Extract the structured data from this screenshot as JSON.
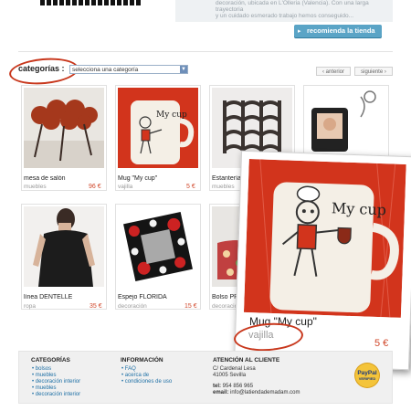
{
  "header": {
    "intro_line1": "decoración, ubicada en L'Olleria (Valencia). Con una larga trayectoria",
    "intro_line2": "y un cuidado esmerado trabajo hemos conseguido...",
    "recommend_button": "recomienda la tienda"
  },
  "filter": {
    "label": "categorías :",
    "select_value": "selecciona una categoría",
    "prev": "‹ anterior",
    "next": "siguiente ›"
  },
  "products": [
    {
      "name": "mesa de salón",
      "category": "muebles",
      "price": "96 €"
    },
    {
      "name": "Mug \"My cup\"",
      "category": "vajilla",
      "price": "5 €"
    },
    {
      "name": "Estantería BO",
      "category": "muebles",
      "price": ""
    },
    {
      "name": "",
      "category": "",
      "price": ""
    },
    {
      "name": "línea DENTELLE",
      "category": "ropa",
      "price": "35 €"
    },
    {
      "name": "Espejo FLORIDA",
      "category": "decoración",
      "price": "15 €"
    },
    {
      "name": "Bolso PRI",
      "category": "decoració",
      "price": ""
    }
  ],
  "zoom": {
    "name": "Mug \"My cup\"",
    "category": "vajilla",
    "price": "5 €",
    "mug_text": "My cup"
  },
  "footer": {
    "categories": {
      "title": "CATEGORÍAS",
      "links": [
        "bolsos",
        "muebles",
        "decoración interior",
        "muebles",
        "decoración interior"
      ]
    },
    "info": {
      "title": "INFORMACIÓN",
      "links": [
        "FAQ",
        "acerca de",
        "condiciones de uso"
      ]
    },
    "contact": {
      "title": "ATENCIÓN AL CLIENTE",
      "street": "C/ Cardenal Lesa",
      "city": "41005 Sevilla",
      "tel_label": "tel:",
      "tel": "954 856 965",
      "email_label": "email:",
      "email": "info@latiendademadam.com"
    },
    "paypal_label": "PayPal",
    "paypal_sub": "VERIFIED"
  },
  "colors": {
    "accent_red": "#c8371c",
    "price_red": "#d0472a",
    "button_blue": "#5aa4c6",
    "link_blue": "#1d6fa5"
  }
}
